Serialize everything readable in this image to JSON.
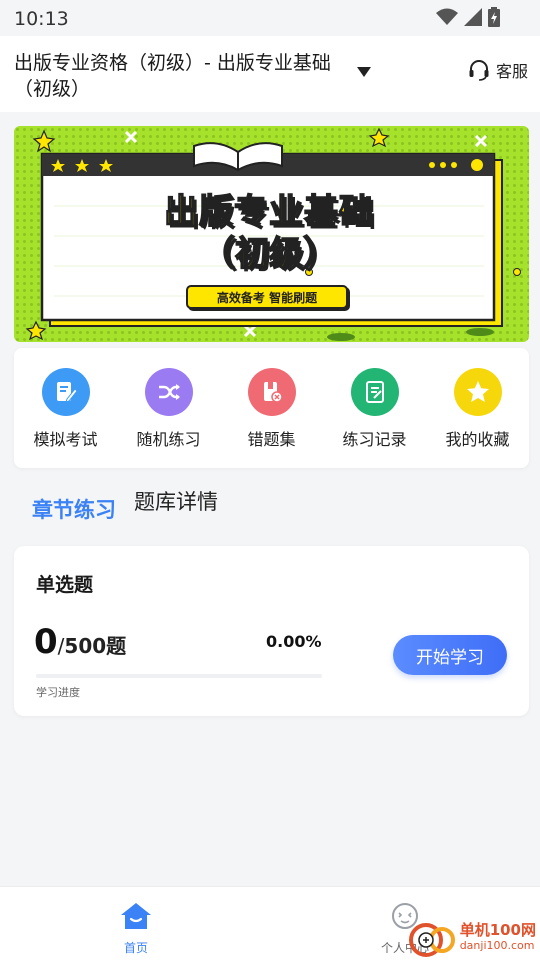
{
  "status_bar": {
    "time": "10:13"
  },
  "header": {
    "title": "出版专业资格（初级）- 出版专业基础（初级）",
    "service_label": "客服"
  },
  "banner": {
    "title_line1": "出版专业基础",
    "title_line2": "（初级）",
    "tagline": "高效备考 智能刷题"
  },
  "shortcuts": [
    {
      "label": "模拟考试",
      "icon": "exam-icon",
      "color": "#3d9bf5"
    },
    {
      "label": "随机练习",
      "icon": "shuffle-icon",
      "color": "#9b7bf2"
    },
    {
      "label": "错题集",
      "icon": "wrong-questions-icon",
      "color": "#f06a73"
    },
    {
      "label": "练习记录",
      "icon": "record-icon",
      "color": "#22b573"
    },
    {
      "label": "我的收藏",
      "icon": "star-icon",
      "color": "#f5d70c"
    }
  ],
  "tabs": {
    "chapter": "章节练习",
    "bank": "题库详情"
  },
  "question_card": {
    "title": "单选题",
    "done": "0",
    "total": "500",
    "unit": "题",
    "percent_text": "0.00%",
    "progress_fraction": 0,
    "progress_label": "学习进度",
    "start_button": "开始学习"
  },
  "tabbar": {
    "home": "首页",
    "profile": "个人中心"
  },
  "watermark": {
    "name": "单机100网",
    "url": "danji100.com"
  },
  "colors": {
    "accent": "#3b82f6",
    "banner_green": "#a6e22b",
    "banner_yellow": "#ffe600"
  }
}
